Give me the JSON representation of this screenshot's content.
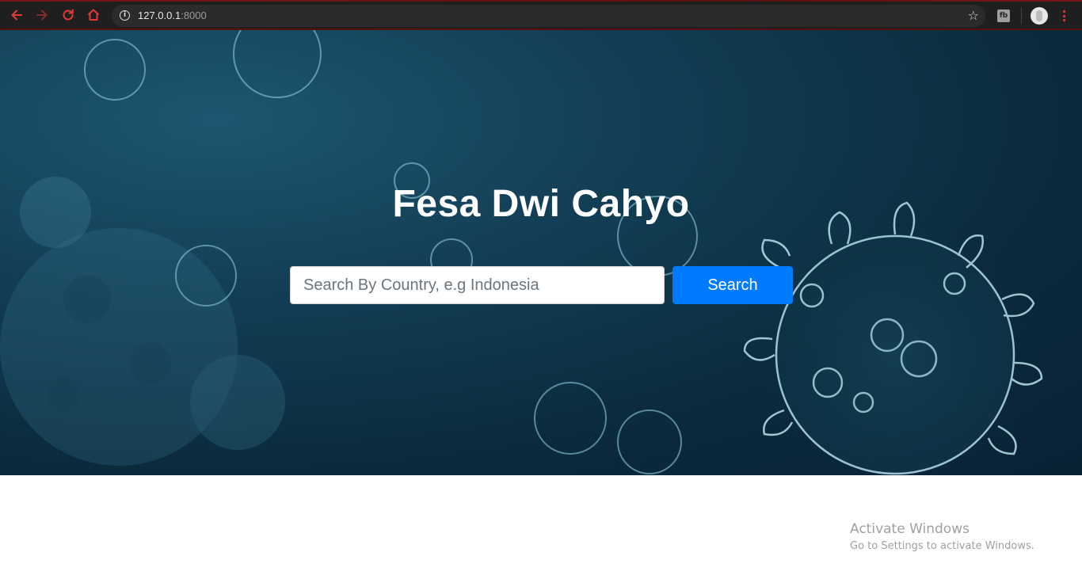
{
  "browser": {
    "url_host": "127.0.0.1",
    "url_port": ":8000",
    "icons": {
      "back": "arrow-left-icon",
      "forward": "arrow-right-icon",
      "reload": "reload-icon",
      "home": "home-icon",
      "info": "info-icon",
      "bookmark": "star-icon",
      "extension": "extension-icon",
      "menu": "kebab-menu-icon"
    },
    "extension_label": "fb",
    "info_glyph": "i",
    "star_glyph": "☆"
  },
  "hero": {
    "title": "Fesa Dwi Cahyo",
    "search_placeholder": "Search By Country, e.g Indonesia",
    "search_button_label": "Search"
  },
  "watermark": {
    "title": "Activate Windows",
    "subtitle": "Go to Settings to activate Windows."
  },
  "colors": {
    "accent_red": "#e53935",
    "primary_button": "#007bff",
    "hero_dark": "#0b2a3c",
    "hero_light": "#1d5670"
  }
}
